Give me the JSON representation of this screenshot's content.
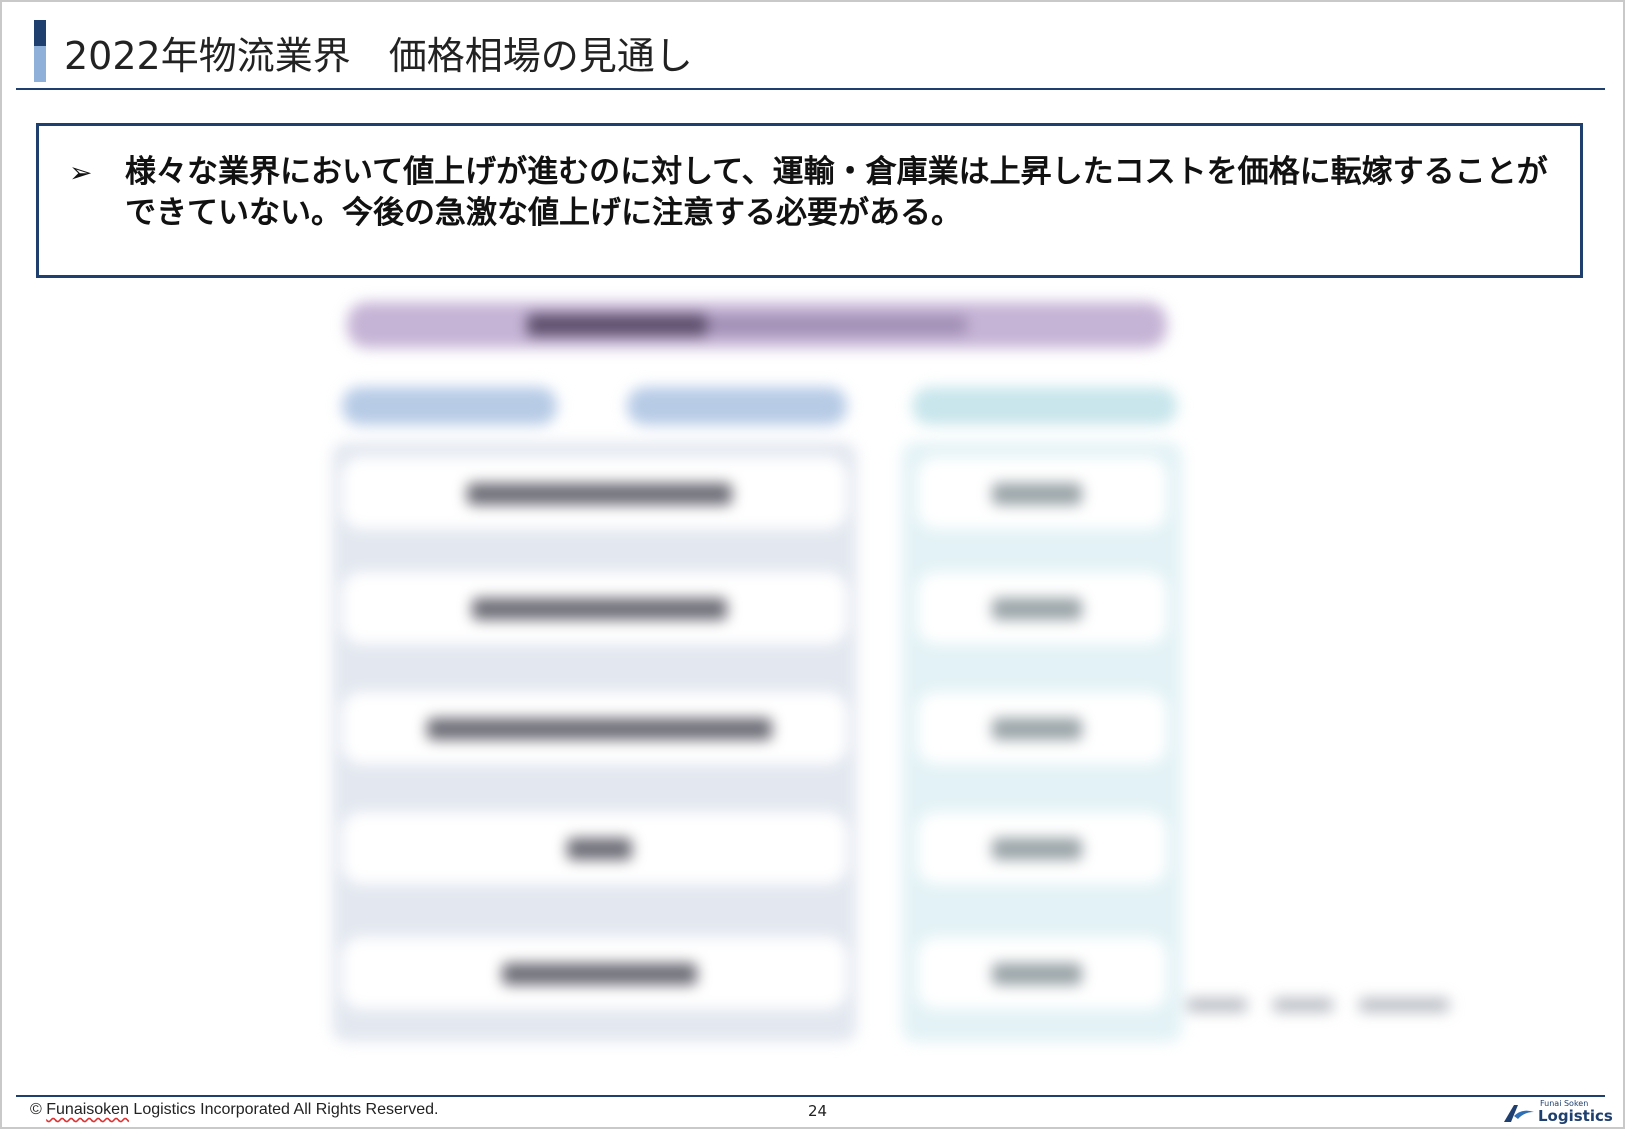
{
  "slide": {
    "title": "2022年物流業界　価格相場の見通し",
    "summary": {
      "bullet_glyph": "➢",
      "text": "様々な業界において値上げが進むのに対して、運輸・倉庫業は上昇したコストを価格に転嫁することができていない。今後の急激な値上げに注意する必要がある。"
    }
  },
  "footer": {
    "copyright_symbol": "©",
    "company_word": "Funaisoken",
    "copyright_rest": "Logistics Incorporated All Rights Reserved.",
    "page_number": "24",
    "logo_line1": "Funai Soken",
    "logo_line2": "Logistics"
  },
  "colors": {
    "primary": "#1f3f6e",
    "accent_light": "#8fb0d8",
    "figure_header": "#c6b4d6",
    "figure_left": "#b7cbe6",
    "figure_right": "#c8e6ec"
  }
}
